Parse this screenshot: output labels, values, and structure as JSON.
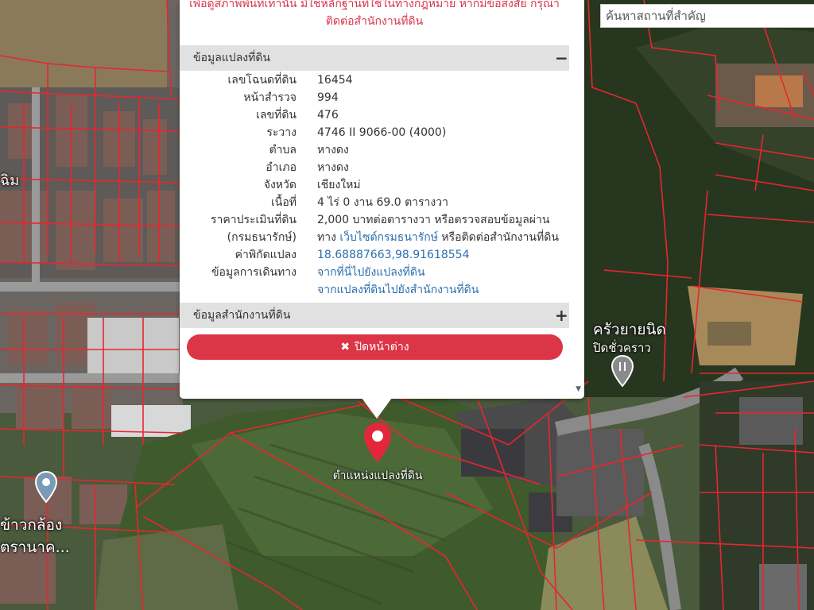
{
  "search": {
    "placeholder": "ค้นหาสถานที่สำคัญ"
  },
  "popup": {
    "disclaimer_lines": [
      "เพื่อดูสภาพพื้นที่เท่านั้น มิใช่หลักฐานที่ใช้ในทางกฎหมาย หากมีข้อสงสัย กรุณา",
      "ติดต่อสำนักงานที่ดิน"
    ],
    "parcel_section": {
      "title": "ข้อมูลแปลงที่ดิน",
      "toggle": "−"
    },
    "fields": {
      "deed_no": {
        "label": "เลขโฉนดที่ดิน",
        "value": "16454"
      },
      "survey_page": {
        "label": "หน้าสำรวจ",
        "value": "994"
      },
      "land_no": {
        "label": "เลขที่ดิน",
        "value": "476"
      },
      "grid": {
        "label": "ระวาง",
        "value": "4746 II 9066-00 (4000)"
      },
      "subdistrict": {
        "label": "ตำบล",
        "value": "หางดง"
      },
      "district": {
        "label": "อำเภอ",
        "value": "หางดง"
      },
      "province": {
        "label": "จังหวัด",
        "value": "เชียงใหม่"
      },
      "area": {
        "label": "เนื้อที่",
        "value": "4 ไร่ 0 งาน 69.0 ตารางวา"
      },
      "appraisal": {
        "label_line1": "ราคาประเมินที่ดิน",
        "label_line2": "(กรมธนารักษ์)",
        "value_line1": "2,000 บาทต่อตารางวา หรือตรวจสอบข้อมูลผ่าน",
        "value_pre": "ทาง ",
        "value_link": "เว็บไซต์กรมธนารักษ์",
        "value_post": " หรือติดต่อสำนักงานที่ดิน"
      },
      "coords": {
        "label": "ค่าพิกัดแปลง",
        "value": "18.68887663,98.91618554"
      },
      "directions": {
        "label": "ข้อมูลการเดินทาง",
        "link1": "จากที่นี่ไปยังแปลงที่ดิน",
        "link2": "จากแปลงที่ดินไปยังสำนักงานที่ดิน"
      }
    },
    "office_section": {
      "title": "ข้อมูลสำนักงานที่ดิน",
      "toggle": "+"
    },
    "close_button": "ปิดหน้าต่าง",
    "scroll_down": "▼"
  },
  "map": {
    "pin_label": "ตำแหน่งแปลงที่ดิน",
    "labels": {
      "place1_line1": "ครัวยายนิด",
      "place1_line2": "ปิดชั่วคราว",
      "place2_line1": "ข้าวกล้อง",
      "place2_line2": "ตรานาค...",
      "place3": "ฉิม"
    },
    "colors": {
      "parcel_line": "#e8262e",
      "pin": "#e3263a",
      "link": "#2c6fb0",
      "close_button": "#dc3545"
    }
  }
}
